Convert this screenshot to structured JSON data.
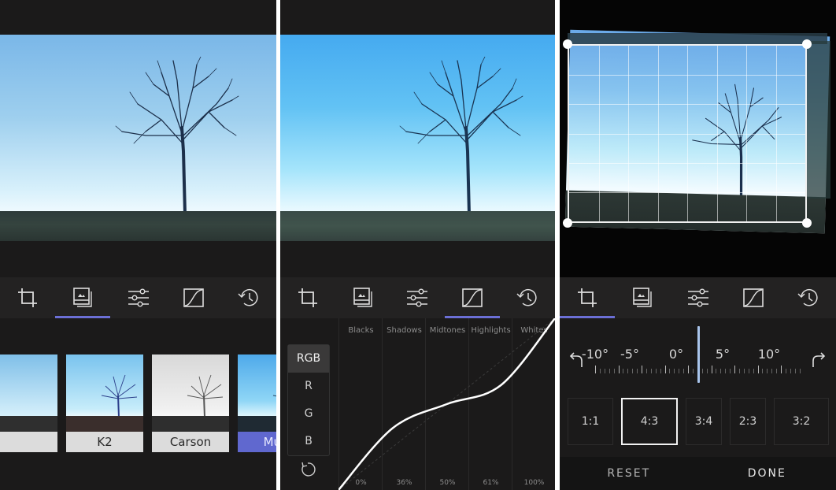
{
  "toolbar": {
    "tools": [
      {
        "id": "crop",
        "icon": "crop-icon"
      },
      {
        "id": "filters",
        "icon": "filters-icon"
      },
      {
        "id": "adjust",
        "icon": "sliders-icon"
      },
      {
        "id": "curves",
        "icon": "curves-icon"
      },
      {
        "id": "history",
        "icon": "history-icon"
      }
    ],
    "accent_color": "#6b6fd6"
  },
  "panel_filters": {
    "active_tool": "filters",
    "filters": [
      {
        "label": "",
        "selected": false
      },
      {
        "label": "K2",
        "selected": false
      },
      {
        "label": "Carson",
        "selected": false
      },
      {
        "label": "Muir",
        "selected": true
      }
    ],
    "selected_color": "#6068cf"
  },
  "panel_curves": {
    "active_tool": "curves",
    "channels": [
      "RGB",
      "R",
      "G",
      "B"
    ],
    "active_channel": "RGB",
    "columns": [
      {
        "label": "Blacks",
        "value": "0%"
      },
      {
        "label": "Shadows",
        "value": "36%"
      },
      {
        "label": "Midtones",
        "value": "50%"
      },
      {
        "label": "Highlights",
        "value": "61%"
      },
      {
        "label": "Whites",
        "value": "100%"
      }
    ],
    "curve_points": [
      [
        0,
        0
      ],
      [
        0.25,
        0.36
      ],
      [
        0.5,
        0.5
      ],
      [
        0.75,
        0.61
      ],
      [
        1,
        1
      ]
    ]
  },
  "panel_crop": {
    "active_tool": "crop",
    "rotation_labels": [
      "-10°",
      "-5°",
      "0°",
      "5°",
      "10°"
    ],
    "rotation_degrees": 1.5,
    "aspect_ratios": [
      "1:1",
      "4:3",
      "3:4",
      "2:3",
      "3:2"
    ],
    "selected_ratio": "4:3",
    "reset_label": "RESET",
    "done_label": "DONE"
  }
}
